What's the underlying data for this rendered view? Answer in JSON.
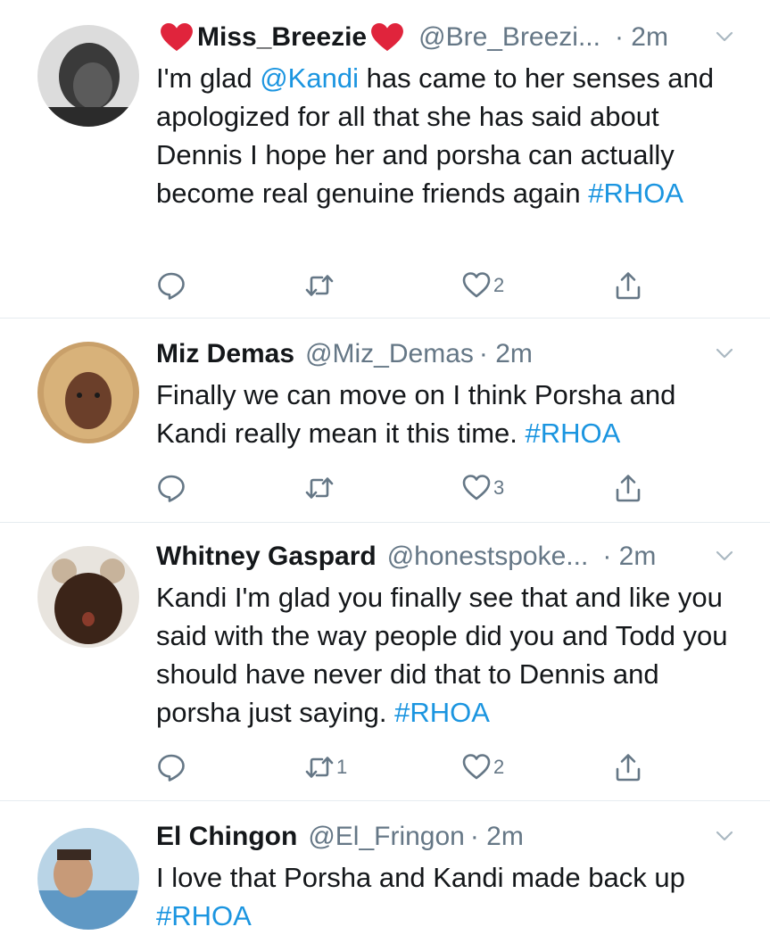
{
  "colors": {
    "accent": "#1b95e0",
    "muted": "#657786",
    "text": "#14171a",
    "divider": "#e6ecf0",
    "heart_emoji": "#e0243c"
  },
  "tweets": [
    {
      "name": "Miss_Breezie",
      "name_has_heart_emojis": true,
      "handle": "@Bre_Breezi...",
      "time": "· 2m",
      "text_before": "I'm glad ",
      "mention": "@Kandi",
      "text_after": " has came to her senses and apologized for all that she has said about Dennis I hope her and porsha can actually become real genuine friends again ",
      "hashtag": "#RHOA",
      "reply_count": "",
      "retweet_count": "",
      "like_count": "2",
      "icons": [
        "reply-icon",
        "retweet-icon",
        "like-icon",
        "share-icon"
      ]
    },
    {
      "name": "Miz Demas",
      "handle": "@Miz_Demas",
      "time": "· 2m",
      "text": "Finally we can move on I think Porsha and Kandi really mean it this time.  ",
      "hashtag": "#RHOA",
      "reply_count": "",
      "retweet_count": "",
      "like_count": "3"
    },
    {
      "name": "Whitney Gaspard",
      "handle": "@honestspoke...",
      "time": "· 2m",
      "text": "Kandi I'm glad you finally see that and like you said with the way people did you and Todd you should have never did that to Dennis and porsha just saying.  ",
      "hashtag": "#RHOA",
      "reply_count": "",
      "retweet_count": "1",
      "like_count": "2"
    },
    {
      "name": "El Chingon",
      "handle": "@El_Fringon",
      "time": "· 2m",
      "text": "I love that Porsha and Kandi made back up ",
      "hashtag": "#RHOA"
    }
  ]
}
